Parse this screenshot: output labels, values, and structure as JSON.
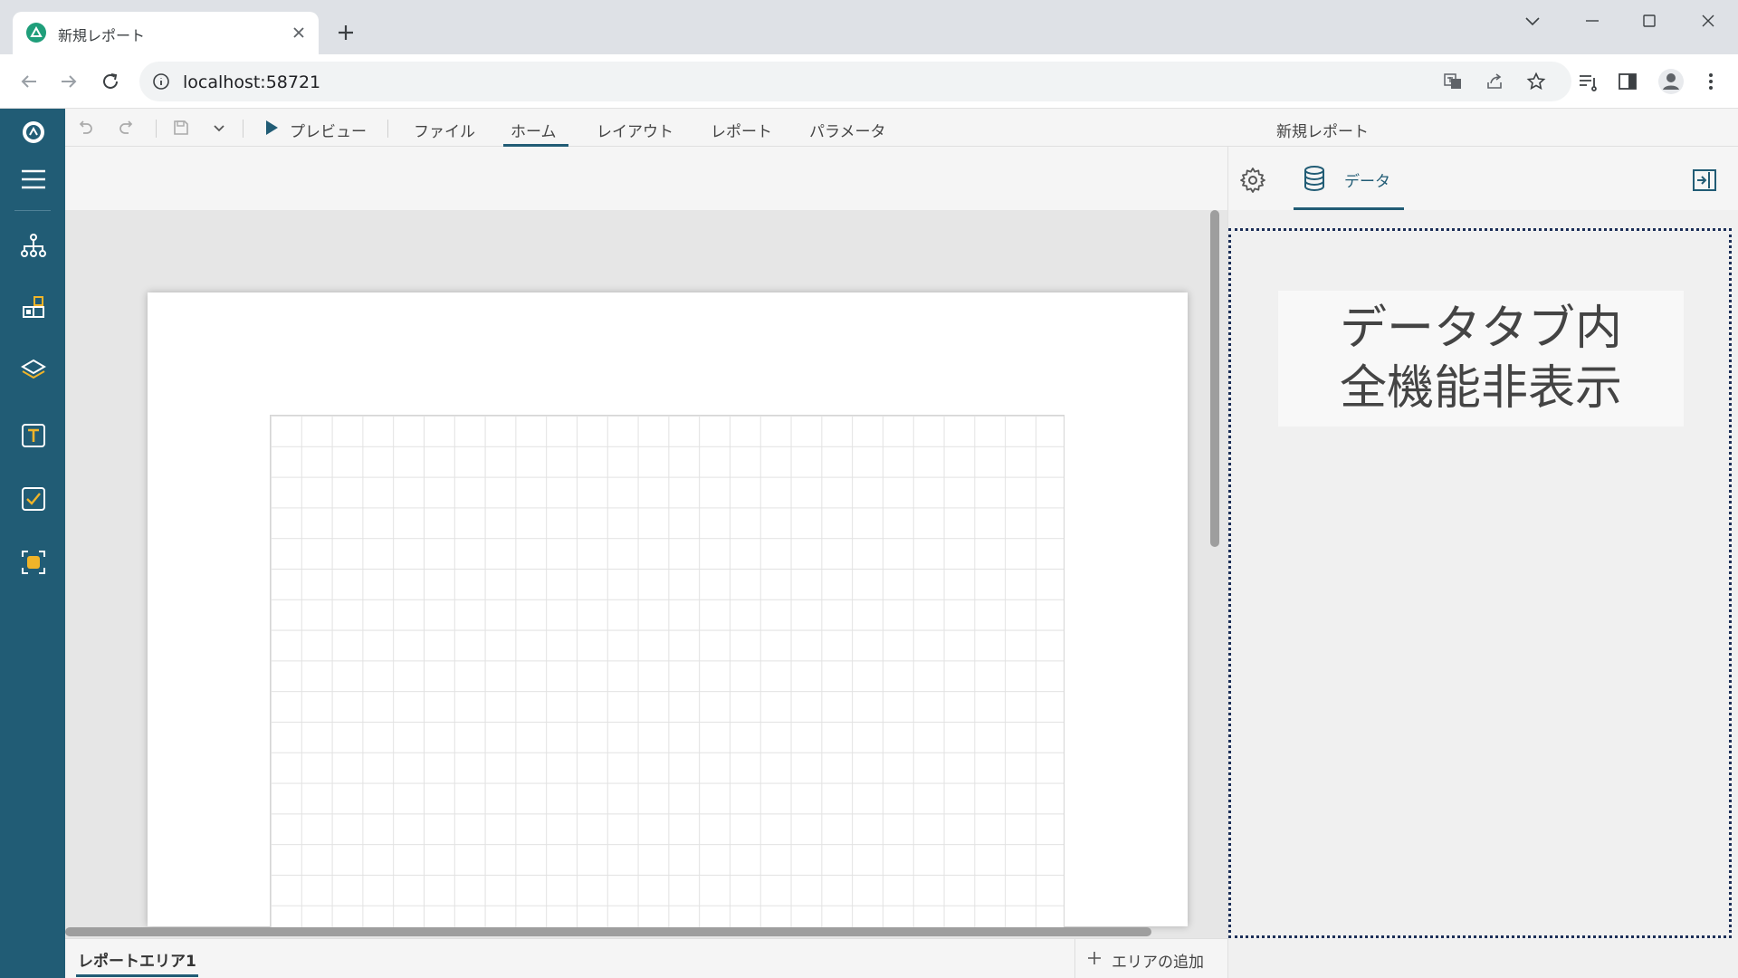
{
  "browser": {
    "tab_title": "新規レポート",
    "url": "localhost:58721"
  },
  "menubar": {
    "preview_label": "プレビュー",
    "items": [
      {
        "label": "ファイル"
      },
      {
        "label": "ホーム",
        "active": true
      },
      {
        "label": "レイアウト"
      },
      {
        "label": "レポート"
      },
      {
        "label": "パラメータ"
      }
    ],
    "document_title": "新規レポート"
  },
  "rail": {
    "icons": [
      "menu-icon",
      "hierarchy-icon",
      "components-icon",
      "layers-icon",
      "text-icon",
      "checkbox-icon",
      "image-icon"
    ]
  },
  "workspace": {
    "area_tab": "レポートエリア1",
    "add_area_label": "エリアの追加"
  },
  "right_panel": {
    "data_tab_label": "データ",
    "note_text": "データタブ内\n全機能非表示"
  },
  "colors": {
    "rail": "#215c75",
    "accent": "#215c75",
    "drop_border": "#1b2e57",
    "brand_green": "#1f9e7a"
  }
}
